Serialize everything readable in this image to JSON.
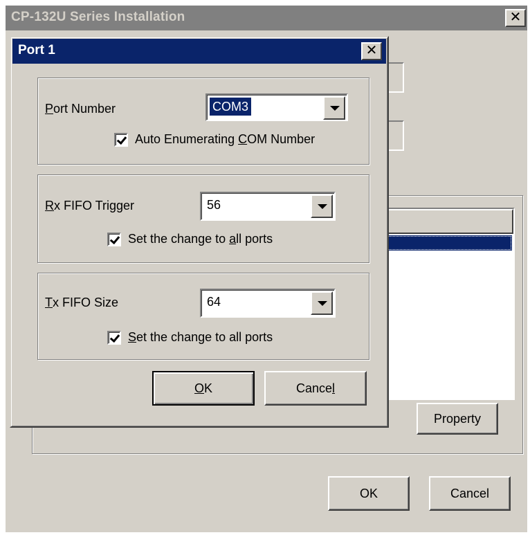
{
  "main_window": {
    "title": "CP-132U Series Installation",
    "close_glyph": "✕",
    "property_button": "Property",
    "ok_button": "OK",
    "cancel_button": "Cancel"
  },
  "dialog": {
    "title": "Port 1",
    "close_glyph": "✕",
    "port_number": {
      "label_mnemonic": "P",
      "label_rest": "ort Number",
      "value": "COM3",
      "checkbox_pre": "Auto Enumerating ",
      "checkbox_mnemonic": "C",
      "checkbox_post": "OM Number",
      "checked": true
    },
    "rx_fifo": {
      "label_mnemonic": "R",
      "label_rest": "x FIFO Trigger",
      "value": "56",
      "checkbox_pre": "Set the change to ",
      "checkbox_mnemonic": "a",
      "checkbox_post": "ll ports",
      "checked": true
    },
    "tx_fifo": {
      "label_mnemonic": "T",
      "label_rest": "x FIFO Size",
      "value": "64",
      "checkbox_pre": "",
      "checkbox_mnemonic": "S",
      "checkbox_post": "et the change to all ports",
      "checked": true
    },
    "ok_mnemonic": "O",
    "ok_rest": "K",
    "cancel_pre": "Cance",
    "cancel_mnemonic": "l"
  }
}
